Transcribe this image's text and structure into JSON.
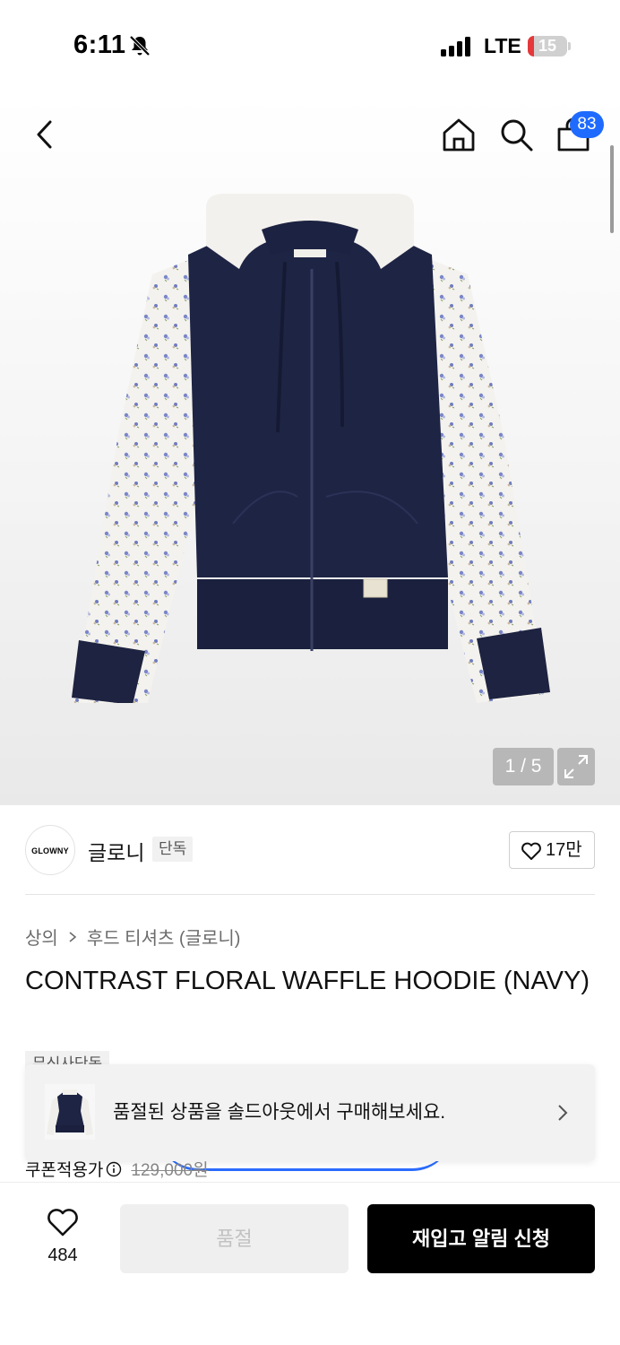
{
  "status_bar": {
    "time": "6:11",
    "network": "LTE",
    "battery": "15",
    "battery_level": 0.15
  },
  "header": {
    "cart_badge": "83",
    "icons": [
      "back-icon",
      "home-icon",
      "search-icon",
      "cart-icon"
    ]
  },
  "gallery": {
    "counter": "1 / 5",
    "image_desc_icon": "hoodie-product-image"
  },
  "brand": {
    "logo_text": "GLOWNY",
    "name": "글로니",
    "tag": "단독",
    "likes": "17만"
  },
  "breadcrumb": {
    "category": "상의",
    "subcategory": "후드 티셔츠 (글로니)"
  },
  "product": {
    "title": "CONTRAST FLORAL WAFFLE HOODIE (NAVY)",
    "exclusive_tag": "무신사단독",
    "coupon_label": "쿠폰적용가",
    "original_price": "129,000원"
  },
  "soldout_banner": {
    "text": "품절된 상품을 솔드아웃에서 구매해보세요."
  },
  "bottom_bar": {
    "wish_count": "484",
    "soldout_label": "품절",
    "restock_label": "재입고 알림 신청"
  },
  "colors": {
    "accent_blue": "#1f6bff",
    "navy": "#1d2340",
    "black": "#000000"
  }
}
